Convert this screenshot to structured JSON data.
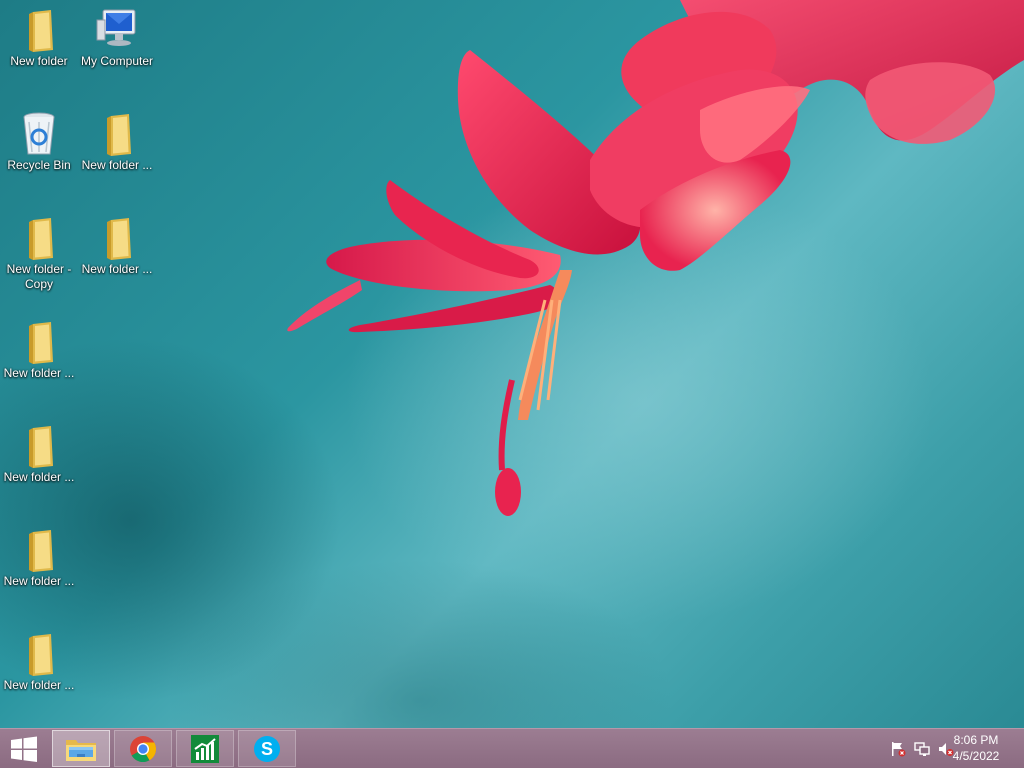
{
  "desktop": {
    "icons": [
      {
        "label": "New folder",
        "icon": "folder-icon"
      },
      {
        "label": "My Computer",
        "icon": "computer-icon"
      },
      {
        "label": "Recycle Bin",
        "icon": "recycle-bin-icon"
      },
      {
        "label": "New folder ...",
        "icon": "folder-icon"
      },
      {
        "label": "New folder -\nCopy",
        "icon": "folder-icon"
      },
      {
        "label": "New folder ...",
        "icon": "folder-icon"
      },
      {
        "label": "New folder ...",
        "icon": "folder-icon"
      },
      {
        "label": "New folder ...",
        "icon": "folder-icon"
      },
      {
        "label": "New folder ...",
        "icon": "folder-icon"
      },
      {
        "label": "New folder ...",
        "icon": "folder-icon"
      }
    ]
  },
  "taskbar": {
    "start_icon": "windows-logo-icon",
    "pinned": [
      {
        "app": "File Explorer",
        "icon": "file-explorer-icon",
        "active": true
      },
      {
        "app": "Google Chrome",
        "icon": "chrome-icon",
        "active": false
      },
      {
        "app": "Stock chart app",
        "icon": "stock-chart-icon",
        "active": false
      },
      {
        "app": "Skype",
        "icon": "skype-icon",
        "active": false
      }
    ],
    "tray": {
      "icons": [
        "action-center-flag-icon",
        "network-icon",
        "volume-muted-icon"
      ],
      "time": "8:06 PM",
      "date": "4/5/2022"
    }
  },
  "colors": {
    "taskbar": "#8b6b81",
    "wallpaper_teal": "#2b96a1",
    "flower_red": "#e8234f"
  }
}
